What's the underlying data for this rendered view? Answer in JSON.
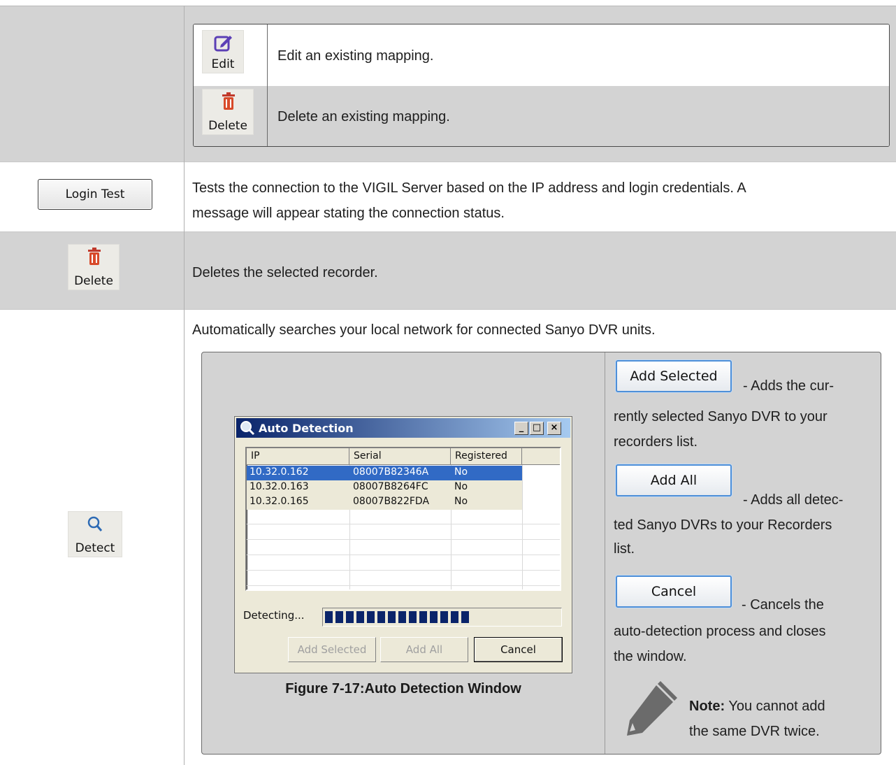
{
  "rows": {
    "edit_button": {
      "label": "Edit"
    },
    "edit_desc": "Edit an existing mapping.",
    "delete_button": {
      "label": "Delete"
    },
    "delete_desc": "Delete an existing mapping.",
    "login_test": {
      "label": "Login Test",
      "desc_line1": "Tests the connection to the VIGIL Server based on the IP address and login credentials. A",
      "desc_line2": "message will appear stating the connection status."
    },
    "delete_recorder": {
      "label": "Delete",
      "desc": "Deletes the selected recorder."
    },
    "detect": {
      "label": "Detect",
      "desc": "Automatically searches your local network for connected Sanyo DVR units."
    }
  },
  "auto_detection": {
    "title": "Auto Detection",
    "columns": [
      "IP",
      "Serial",
      "Registered"
    ],
    "rows": [
      [
        "10.32.0.162",
        "08007B82346A",
        "No"
      ],
      [
        "10.32.0.163",
        "08007B8264FC",
        "No"
      ],
      [
        "10.32.0.165",
        "08007B822FDA",
        "No"
      ]
    ],
    "selected_row": 0,
    "status": "Detecting...",
    "progress_blocks": 14,
    "buttons": {
      "add_selected": "Add Selected",
      "add_all": "Add All",
      "cancel": "Cancel"
    },
    "caption": "Figure 7-17:Auto Detection Window"
  },
  "side_help": {
    "add_selected": {
      "label": "Add Selected",
      "text_a": "- Adds the cur-",
      "text_b": "rently selected Sanyo DVR to your",
      "text_c": "recorders list."
    },
    "add_all": {
      "label": "Add All",
      "text_a": "- Adds all detec-",
      "text_b": "ted Sanyo DVRs to your Recorders",
      "text_c": "list."
    },
    "cancel": {
      "label": "Cancel",
      "text_a": "- Cancels the",
      "text_b": "auto-detection process and closes",
      "text_c": "the window."
    },
    "note": {
      "bold": "Note:",
      "text_a": "You cannot add",
      "text_b": "the same DVR twice."
    }
  },
  "colors": {
    "row_gray": "#d3d3d3",
    "selection_blue": "#316ac5",
    "title_blue": "#0a246a",
    "progress_blue": "#0a246a"
  }
}
